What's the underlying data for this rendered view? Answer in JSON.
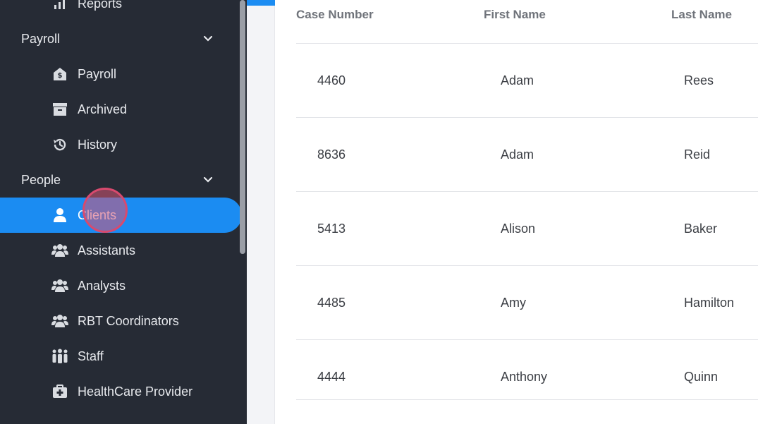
{
  "sidebar": {
    "reports_label": "Reports",
    "payroll_section": "Payroll",
    "payroll_items": [
      {
        "label": "Payroll",
        "icon": "payroll-money-icon"
      },
      {
        "label": "Archived",
        "icon": "archive-box-icon"
      },
      {
        "label": "History",
        "icon": "history-clock-icon"
      }
    ],
    "people_section": "People",
    "people_items": [
      {
        "label": "Clients",
        "icon": "user-icon"
      },
      {
        "label": "Assistants",
        "icon": "users-icon"
      },
      {
        "label": "Analysts",
        "icon": "users-icon"
      },
      {
        "label": "RBT Coordinators",
        "icon": "users-icon"
      },
      {
        "label": "Staff",
        "icon": "people-group-icon"
      },
      {
        "label": "HealthCare Provider",
        "icon": "medkit-icon"
      }
    ],
    "active_item": "Clients",
    "accent_color": "#1b8cf2"
  },
  "table": {
    "columns": [
      "Case Number",
      "First Name",
      "Last Name"
    ],
    "rows": [
      [
        "4460",
        "Adam",
        "Rees"
      ],
      [
        "8636",
        "Adam",
        "Reid"
      ],
      [
        "5413",
        "Alison",
        "Baker"
      ],
      [
        "4485",
        "Amy",
        "Hamilton"
      ],
      [
        "4444",
        "Anthony",
        "Quinn"
      ]
    ]
  }
}
